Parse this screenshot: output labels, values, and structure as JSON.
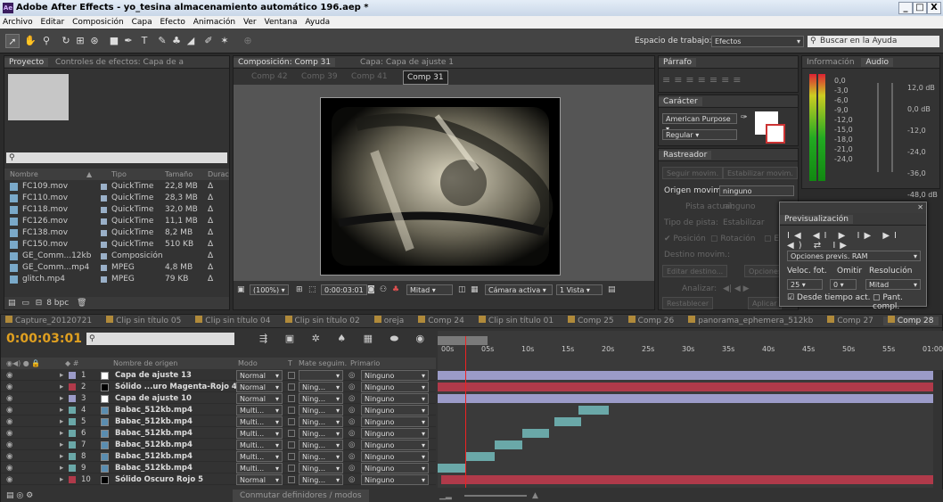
{
  "window": {
    "title": "Adobe After Effects - yo_tesina almacenamiento automático 196.aep *",
    "controls": [
      "_",
      "□",
      "X"
    ]
  },
  "menu": [
    "Archivo",
    "Editar",
    "Composición",
    "Capa",
    "Efecto",
    "Animación",
    "Ver",
    "Ventana",
    "Ayuda"
  ],
  "toolbar": {
    "workspace_label": "Espacio de trabajo:",
    "workspace_value": "Efectos",
    "search_placeholder": "Buscar en la Ayuda"
  },
  "project": {
    "tabs": [
      "Proyecto",
      "Controles de efectos: Capa de a"
    ],
    "columns": [
      "Nombre",
      "Tipo",
      "Tamaño",
      "Duraci"
    ],
    "items": [
      {
        "name": "FC109.mov",
        "type": "QuickTime",
        "size": "22,8 MB",
        "dur": "Δ"
      },
      {
        "name": "FC110.mov",
        "type": "QuickTime",
        "size": "28,3 MB",
        "dur": "Δ"
      },
      {
        "name": "FC118.mov",
        "type": "QuickTime",
        "size": "32,0 MB",
        "dur": "Δ"
      },
      {
        "name": "FC126.mov",
        "type": "QuickTime",
        "size": "11,1 MB",
        "dur": "Δ"
      },
      {
        "name": "FC138.mov",
        "type": "QuickTime",
        "size": "8,2 MB",
        "dur": "Δ"
      },
      {
        "name": "FC150.mov",
        "type": "QuickTime",
        "size": "510 KB",
        "dur": "Δ"
      },
      {
        "name": "GE_Comm...12kb",
        "type": "Composición",
        "size": "",
        "dur": "Δ"
      },
      {
        "name": "GE_Comm...mp4",
        "type": "MPEG",
        "size": "4,8 MB",
        "dur": "Δ"
      },
      {
        "name": "glitch.mp4",
        "type": "MPEG",
        "size": "79 KB",
        "dur": "Δ"
      }
    ],
    "bpc": "8 bpc"
  },
  "composition": {
    "tab": "Composición: Comp 31",
    "layer_tab": "Capa: Capa de ajuste 1",
    "breadcrumbs": [
      "Comp 42",
      "Comp 39",
      "Comp 41",
      "Comp 31"
    ],
    "zoom": "(100%)",
    "timecode": "0:00:03:01",
    "resolution": "Mitad",
    "camera": "Cámara activa",
    "views": "1 Vista"
  },
  "parrafo": {
    "tab": "Párrafo"
  },
  "caracter": {
    "tab": "Carácter",
    "font": "American Purpose",
    "style": "Regular"
  },
  "rastreador": {
    "tab": "Rastreador",
    "btn_track": "Seguir movim.",
    "btn_stab": "Estabilizar movim.",
    "origin_label": "Origen movim.:",
    "origin_value": "ninguno",
    "current_label": "Pista actual:",
    "current_value": "ninguno",
    "type_label": "Tipo de pista:",
    "type_value": "Estabilizar",
    "chk_pos": "Posición",
    "chk_rot": "Rotación",
    "chk_esc": "Esc",
    "target_label": "Destino movim.:",
    "btn_edit_target": "Editar destino...",
    "btn_options": "Opciones",
    "analyze_label": "Analizar:",
    "btn_reset": "Restablecer",
    "btn_apply": "Aplicar"
  },
  "info": {
    "tab_info": "Información",
    "tab_audio": "Audio",
    "left_scale": [
      "0,0",
      "-3,0",
      "-6,0",
      "-9,0",
      "-12,0",
      "-15,0",
      "-18,0",
      "-21,0",
      "-24,0"
    ],
    "right_scale": [
      "12,0 dB",
      "0,0 dB",
      "-12,0",
      "-24,0",
      "-36,0",
      "-48,0 dB"
    ]
  },
  "preview": {
    "tab": "Previsualización",
    "ram_options": "Opciones previs. RAM",
    "fps_label": "Veloc. fot.",
    "skip_label": "Omitir",
    "res_label": "Resolución",
    "fps": "25",
    "skip": "0",
    "res": "Mitad",
    "chk_from_current": "Desde tiempo act.",
    "chk_full": "Pant. compl."
  },
  "timeline": {
    "tabs": [
      "Capture_20120721",
      "Clip sin título 05",
      "Clip sin título 04",
      "Clip sin título 02",
      "oreja",
      "Comp 24",
      "Clip sin título 01",
      "Comp 25",
      "Comp 26",
      "panorama_ephemera_512kb",
      "Comp 27",
      "Comp 28"
    ],
    "timecode": "0:00:03:01",
    "search_placeholder": "",
    "cols": {
      "source": "Nombre de origen",
      "mode": "Modo",
      "t": "T",
      "matte": "Mate seguim.",
      "parent": "Primario"
    },
    "ruler": [
      "00s",
      "05s",
      "10s",
      "15s",
      "20s",
      "25s",
      "30s",
      "35s",
      "40s",
      "45s",
      "50s",
      "55s",
      "01:00s"
    ],
    "layers": [
      {
        "n": "1",
        "name": "Capa de ajuste 13",
        "mode": "Normal",
        "matte": "",
        "parent": "Ninguno",
        "swatch": "#ffffff",
        "color": "#9b9bc8",
        "start": 0,
        "end": 1
      },
      {
        "n": "2",
        "name": "Sólido ...uro Magenta-Rojo 4",
        "mode": "Normal",
        "matte": "Ning...",
        "parent": "Ninguno",
        "swatch": "#000000",
        "color": "#b03a4a",
        "start": 0,
        "end": 1
      },
      {
        "n": "3",
        "name": "Capa de ajuste 10",
        "mode": "Normal",
        "matte": "Ning...",
        "parent": "Ninguno",
        "swatch": "#ffffff",
        "color": "#9b9bc8",
        "start": 0,
        "end": 1
      },
      {
        "n": "4",
        "name": "Babac_512kb.mp4",
        "mode": "Multi...",
        "matte": "Ning...",
        "parent": "Ninguno",
        "swatch": "#5a8db0",
        "color": "#6aa8a8",
        "start": 0.285,
        "end": 0.345
      },
      {
        "n": "5",
        "name": "Babac_512kb.mp4",
        "mode": "Multi...",
        "matte": "Ning...",
        "parent": "Ninguno",
        "swatch": "#5a8db0",
        "color": "#6aa8a8",
        "start": 0.235,
        "end": 0.29
      },
      {
        "n": "6",
        "name": "Babac_512kb.mp4",
        "mode": "Multi...",
        "matte": "Ning...",
        "parent": "Ninguno",
        "swatch": "#5a8db0",
        "color": "#6aa8a8",
        "start": 0.17,
        "end": 0.225
      },
      {
        "n": "7",
        "name": "Babac_512kb.mp4",
        "mode": "Multi...",
        "matte": "Ning...",
        "parent": "Ninguno",
        "swatch": "#5a8db0",
        "color": "#6aa8a8",
        "start": 0.115,
        "end": 0.17
      },
      {
        "n": "8",
        "name": "Babac_512kb.mp4",
        "mode": "Multi...",
        "matte": "Ning...",
        "parent": "Ninguno",
        "swatch": "#5a8db0",
        "color": "#6aa8a8",
        "start": 0.058,
        "end": 0.115
      },
      {
        "n": "9",
        "name": "Babac_512kb.mp4",
        "mode": "Multi...",
        "matte": "Ning...",
        "parent": "Ninguno",
        "swatch": "#5a8db0",
        "color": "#6aa8a8",
        "start": 0,
        "end": 0.058
      },
      {
        "n": "10",
        "name": "Sólido Oscuro Rojo 5",
        "mode": "Normal",
        "matte": "Ning...",
        "parent": "Ninguno",
        "swatch": "#000000",
        "color": "#b03a4a",
        "start": 0.008,
        "end": 1
      }
    ],
    "footer": "Conmutar definidores / modos",
    "playhead": 0.055
  }
}
